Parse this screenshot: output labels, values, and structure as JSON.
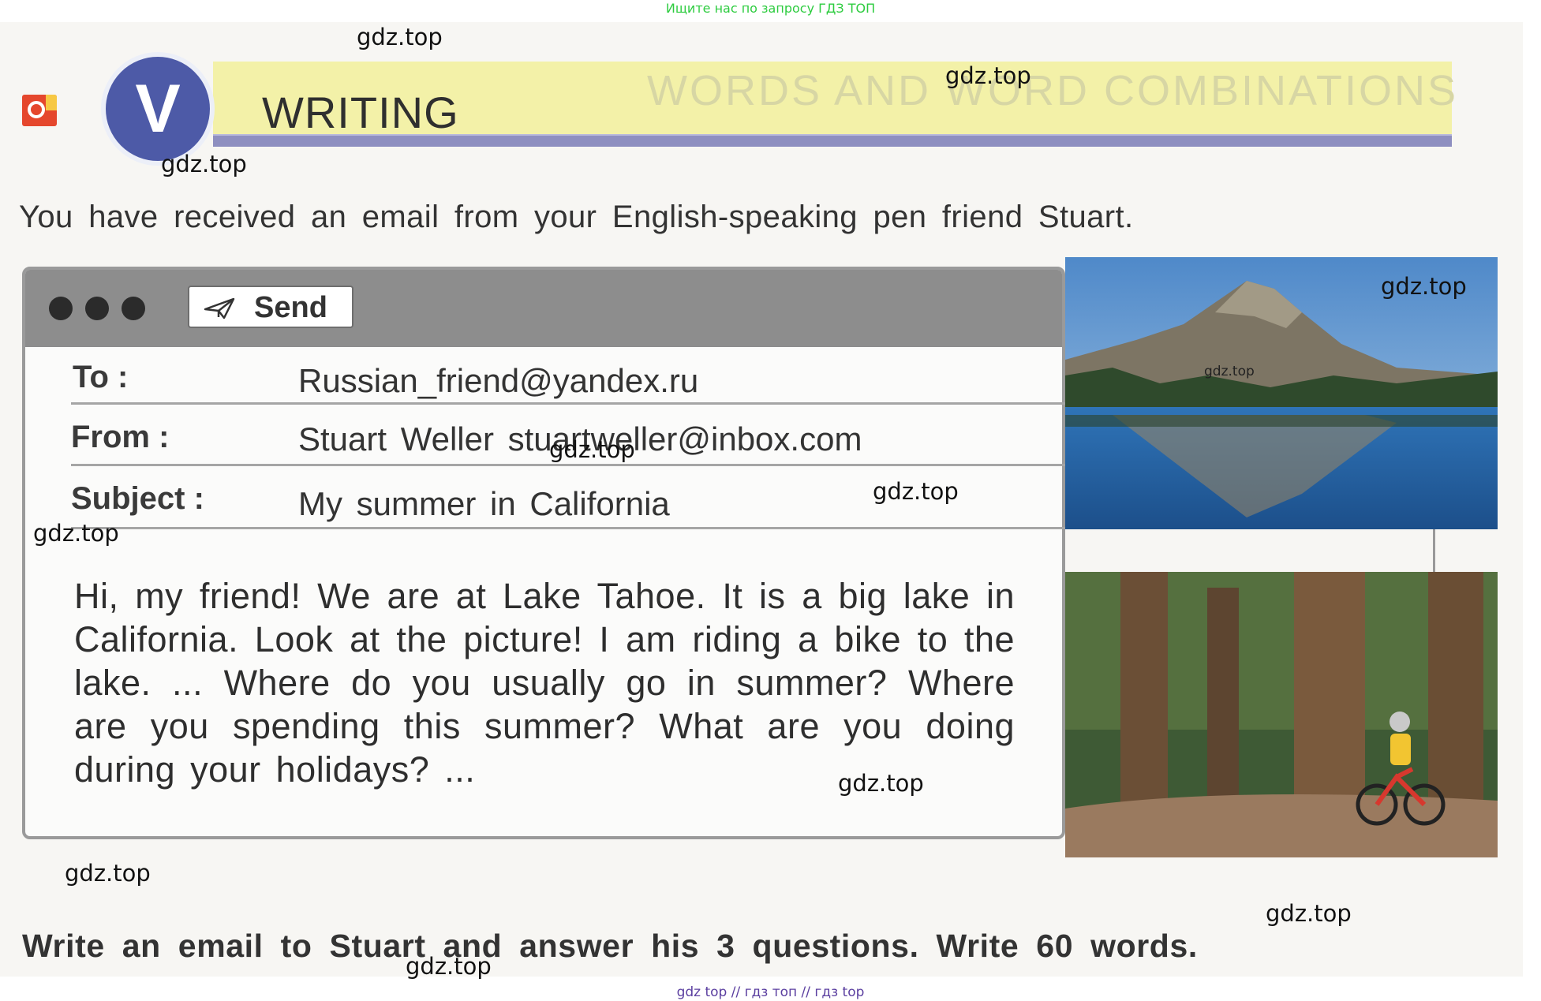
{
  "promo": {
    "top": "Ищите нас по запросу ГДЗ ТОП",
    "bottom": "gdz top  //  гдз топ  //  гдз top"
  },
  "header": {
    "section_letter": "V",
    "title": "WRITING",
    "ghost_text": "WORDS AND WORD COMBINATIONS"
  },
  "intro": "You have received an email from your English-speaking pen friend Stuart.",
  "email": {
    "send_label": "Send",
    "fields": {
      "to_label": "To :",
      "to_value": "Russian_friend@yandex.ru",
      "from_label": "From :",
      "from_value": "Stuart Weller stuartweller@inbox.com",
      "subject_label": "Subject :",
      "subject_value": "My summer in California"
    },
    "body": "Hi, my friend! We are at Lake Tahoe. It is a big lake in California. Look at the picture! I am riding a bike to the lake. ... Where do you usually go in summer? Where are you spending this summer? What are you doing during your holidays? ..."
  },
  "task": "Write an email to Stuart and answer his 3 questions. Write 60 words.",
  "watermark": "gdz.top",
  "colors": {
    "section_circle": "#4d5aa7",
    "header_band": "#f3f1a8",
    "header_underline": "#8e8fc0",
    "toolbar": "#8d8d8d",
    "promo_top": "#2ecc40",
    "promo_bottom": "#5b3fa0"
  },
  "icons": {
    "send": "paper-plane-icon",
    "logo": "publisher-logo-icon"
  }
}
